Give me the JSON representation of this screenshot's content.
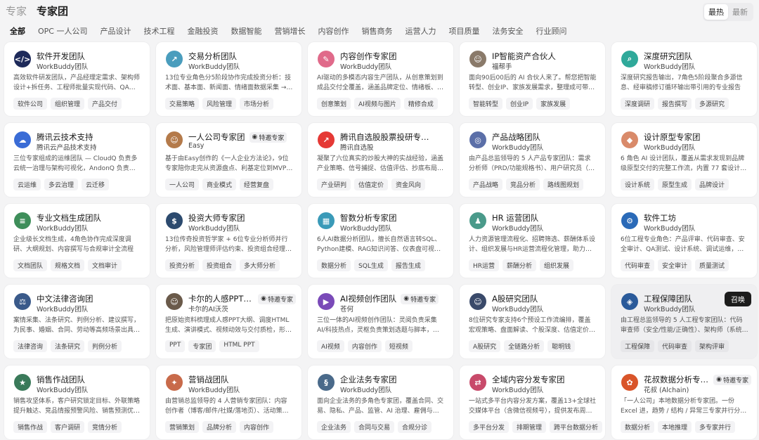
{
  "header": {
    "title_muted": "专家",
    "title_main": "专家团"
  },
  "sort": {
    "hot": "最热",
    "new": "最新",
    "active": "hot"
  },
  "tabs": [
    {
      "label": "全部",
      "active": true
    },
    {
      "label": "OPC 一人公司"
    },
    {
      "label": "产品设计"
    },
    {
      "label": "技术工程"
    },
    {
      "label": "金融投资"
    },
    {
      "label": "数据智能"
    },
    {
      "label": "营销增长"
    },
    {
      "label": "内容创作"
    },
    {
      "label": "销售商务"
    },
    {
      "label": "运营人力"
    },
    {
      "label": "项目质量"
    },
    {
      "label": "法务安全"
    },
    {
      "label": "行业顾问"
    }
  ],
  "cards": [
    {
      "name": "软件开发团队",
      "sub": "WorkBuddy团队",
      "desc": "高效软件研发团队，产品经理定需求、架构师设计+拆任务、工程师批量实现代码、QA验证质量，小需求...",
      "tags": [
        "软件公司",
        "组织管理",
        "产品交付"
      ],
      "icon": "code-icon",
      "color": "#1e2a5a"
    },
    {
      "name": "交易分析团队",
      "sub": "WorkBuddy团队",
      "desc": "13位专业角色分5阶段协作完成投资分析：技术面、基本面、新闻面、情绪面数据采集 → 多空辩论 → ...",
      "tags": [
        "交易策略",
        "风险管理",
        "市场分析"
      ],
      "icon": "chart-icon",
      "color": "#4a9dbd"
    },
    {
      "name": "内容创作专家团",
      "sub": "WorkBuddy团队",
      "desc": "AI驱动的多模态内容生产团队，从创意策划到成品交付全覆盖，涵盖品牌定位、情绪板、广告方向、文...",
      "tags": [
        "创意策划",
        "AI视频与图片",
        "精修合成"
      ],
      "icon": "palette-icon",
      "color": "#e06a8a"
    },
    {
      "name": "IP智能资产合伙人",
      "sub": "福帮手",
      "desc": "面向90后00后的 AI 合伙人来了。帮您把智能转型、创业IP、家族发展需求，整理成可带走的七日行动...",
      "tags": [
        "智能转型",
        "创业IP",
        "家族发展"
      ],
      "icon": "person-icon",
      "color": "#8a7a6a"
    },
    {
      "name": "深度研究团队",
      "sub": "WorkBuddy团队",
      "desc": "深度研究报告输出，7角色5阶段聚合多源信息、经审稿修订循环输出带引用的专业报告",
      "tags": [
        "深度调研",
        "报告撰写",
        "多源研究"
      ],
      "icon": "research-icon",
      "color": "#2fa99a"
    },
    {
      "name": "腾讯云技术支持",
      "sub": "腾讯云产品技术支持",
      "desc": "三位专家组成的运维团队 — CloudQ 负责多云统一治理与架构可视化，AndonQ 负责工单管理与智能问...",
      "tags": [
        "云运维",
        "多云治理",
        "云迁移"
      ],
      "icon": "cloud-icon",
      "color": "#3a6cd6"
    },
    {
      "name": "一人公司专家团",
      "sub": "Easy",
      "desc": "基于由Easy创作的《一人企业方法论》，9位专家陪你走完从资源盘点、利基定位到MVP、转化、复盘的...",
      "tags": [
        "一人公司",
        "商业模式",
        "经营复盘"
      ],
      "icon": "person-icon",
      "color": "#b47a4a",
      "badge": "特邀专家"
    },
    {
      "name": "腾讯自选股股票投研专家团",
      "sub": "腾讯自选股",
      "desc": "凝聚了六位真实的炒股大神的实战经验，涵盖产业策略、信号捕捉、估值评估、抄底布局、基本面研究...",
      "tags": [
        "产业研判",
        "估值定价",
        "资金风向"
      ],
      "icon": "stock-icon",
      "color": "#e53935"
    },
    {
      "name": "产品战略团队",
      "sub": "WorkBuddy团队",
      "desc": "由产品总监领导的 5 人产品专家团队：需求分析师（PRD/功能规格书）、用户研究员（调研综合分析）...",
      "tags": [
        "产品战略",
        "竞品分析",
        "路线图规划"
      ],
      "icon": "strategy-icon",
      "color": "#5b6fa8"
    },
    {
      "name": "设计原型专家团",
      "sub": "WorkBuddy团队",
      "desc": "6 角色 AI 设计团队，覆盖从需求发现到品牌级原型交付的完整工作流，内置 77 套设计系统",
      "tags": [
        "设计系统",
        "原型生成",
        "品牌设计"
      ],
      "icon": "design-icon",
      "color": "#d98a6a"
    },
    {
      "name": "专业文档生成团队",
      "sub": "WorkBuddy团队",
      "desc": "企业级长文档生成，4角色协作完成深度调研、大纲规划、内容撰写与合规审计全流程",
      "tags": [
        "文档团队",
        "规格文档",
        "文档审计"
      ],
      "icon": "doc-icon",
      "color": "#3e8e5a"
    },
    {
      "name": "投资大师专家团",
      "sub": "WorkBuddy团队",
      "desc": "13位传奇投资哲学家 + 6位专业分析师并行分析，风险管理师评估约束、投资组合经理信号聚合投票、...",
      "tags": [
        "投资分析",
        "投资组合",
        "多大师分析"
      ],
      "icon": "invest-icon",
      "color": "#2c4a6e"
    },
    {
      "name": "智数分析专家团",
      "sub": "WorkBuddy团队",
      "desc": "6人AI数据分析团队，擅长自然语言转SQL、Python建模、RAG知识问答、仪表盘可视化与报告生成",
      "tags": [
        "数据分析",
        "SQL生成",
        "报告生成"
      ],
      "icon": "data-icon",
      "color": "#3a9ab8"
    },
    {
      "name": "HR 运营团队",
      "sub": "WorkBuddy团队",
      "desc": "人力资源管理流程化、招聘筛选、薪酬体系设计、组织发展与HR运营流程化管理，助力企业人才战略落地",
      "tags": [
        "HR运营",
        "薪酬分析",
        "组织发展"
      ],
      "icon": "hr-icon",
      "color": "#4a9a8a"
    },
    {
      "name": "软件工坊",
      "sub": "WorkBuddy团队",
      "desc": "6位工程专业角色：产品评审、代码审查、安全审计、QA测试、设计系统、调试运维，覆盖从想法到生产...",
      "tags": [
        "代码审查",
        "安全审计",
        "质量测试"
      ],
      "icon": "workshop-icon",
      "color": "#2a6ab8"
    },
    {
      "name": "中文法律咨询团",
      "sub": "WorkBuddy团队",
      "desc": "案情采集、法条研究、判例分析、建议撰写，为民事、婚姻、合同、劳动等高频场景出具专业法律咨...",
      "tags": [
        "法律咨询",
        "法条研究",
        "判例分析"
      ],
      "icon": "law-icon",
      "color": "#3a5a8a"
    },
    {
      "name": "卡尔的人感PPT专家...",
      "sub": "卡尔的AI沃茨",
      "desc": "把原始资料梳理成人感PPT大纲、调度HTML生成、演讲模式、视频动效与交付质检，形成可演示成果。",
      "tags": [
        "PPT",
        "专家团",
        "HTML PPT"
      ],
      "icon": "person-icon",
      "color": "#6a5a4a",
      "badge": "特邀专家"
    },
    {
      "name": "AI视频创作团队",
      "sub": "苍何",
      "desc": "三位一体的AI视频创作团队：灵阅负责采集AI/科技热点，灵枢负责策划选题与脚本，灵映负责渲染MP4...",
      "tags": [
        "AI视频",
        "内容创作",
        "短视频"
      ],
      "icon": "video-icon",
      "color": "#7a4ab8",
      "badge": "特邀专家"
    },
    {
      "name": "A股研究团队",
      "sub": "WorkBuddy团队",
      "desc": "8位研究专家支持6个预设工作流编排，覆盖宏观策略、盘面解读、个股深度、估值定价、产业链映射...",
      "tags": [
        "A股研究",
        "全链路分析",
        "聪明钱"
      ],
      "icon": "person-icon",
      "color": "#3a4a6a"
    },
    {
      "name": "工程保障团队",
      "sub": "WorkBuddy团队",
      "desc": "由工程总监领导的 5 人工程专家团队：代码审查师（安全/性能/正确性）、架构师（系统设计/ADR）、...",
      "tags": [
        "工程保障",
        "代码审查",
        "架构评审"
      ],
      "icon": "shield-icon",
      "color": "#2a5a9a",
      "highlighted": true,
      "action": "召唤"
    },
    {
      "name": "销售作战团队",
      "sub": "WorkBuddy团队",
      "desc": "销售攻坚体系，客户研究锁定目标、外联策略提升触达、竞品情报预警风险、销售预测优化资源分配",
      "tags": [
        "销售作战",
        "客户调研",
        "竞情分析"
      ],
      "icon": "sales-icon",
      "color": "#3a7a5a"
    },
    {
      "name": "营销战团队",
      "sub": "WorkBuddy团队",
      "desc": "由营销总监领导的 4 人营销专家团队：内容创作者（博客/邮件/社媒/落地页）、活动策划师（战役策...",
      "tags": [
        "营销策划",
        "品牌分析",
        "内容创作"
      ],
      "icon": "marketing-icon",
      "color": "#c86a4a"
    },
    {
      "name": "企业法务专家团",
      "sub": "WorkBuddy团队",
      "desc": "面向企业法务的多角色专家团，覆盖合同、交易、隐私、产品、监管、AI 治理、雇佣与知识产权分诊。",
      "tags": [
        "企业法务",
        "合同与交易",
        "合规分诊"
      ],
      "icon": "legal-icon",
      "color": "#4a6a8a"
    },
    {
      "name": "全域内容分发专家团",
      "sub": "WorkBuddy团队",
      "desc": "一站式多平台内容分发方案，覆盖13+全球社交媒体平台（含微信视频号），提供发布周期追配、排期管...",
      "tags": [
        "多平台分发",
        "排期管理",
        "跨平台数据分析"
      ],
      "icon": "distribute-icon",
      "color": "#c84a6a"
    },
    {
      "name": "花叔数据分析专家团",
      "sub": "花叔 (Alchain)",
      "desc": "「一人公司」本地数据分析专家团。一份 Excel 进，趋势 / 结构 / 异常三专家并行分析，交付网页、...",
      "tags": [
        "数据分析",
        "本地推理",
        "多专家并行"
      ],
      "icon": "flower-icon",
      "color": "#d9552a",
      "badge": "特邀专家"
    }
  ]
}
